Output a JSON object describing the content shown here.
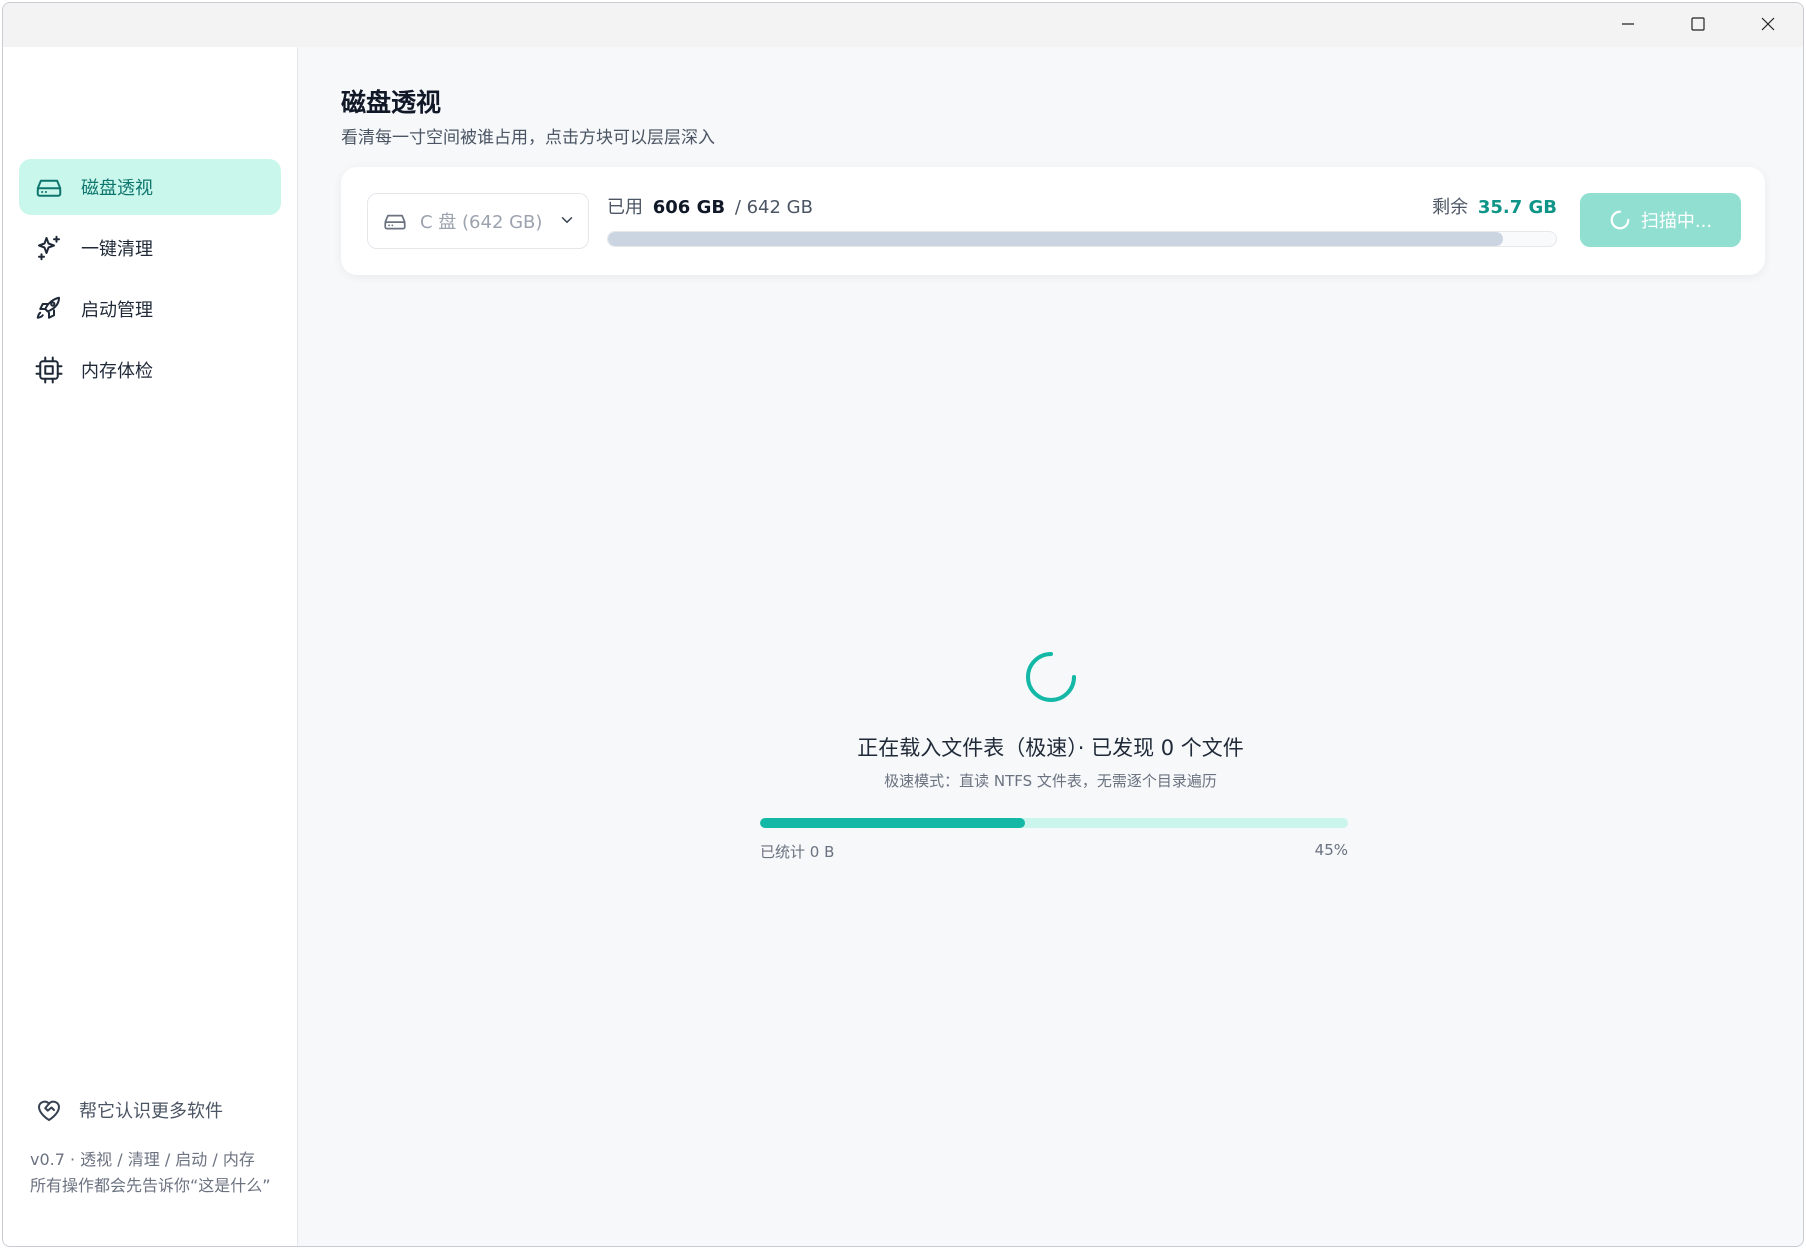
{
  "colors": {
    "accent": "#14b8a6",
    "accent_dark": "#0f766e",
    "active_nav_bg": "#c9f7ec",
    "scan_button_bg": "#90dfd1",
    "usage_bar_fill": "#cbd5e1"
  },
  "window_controls": {
    "minimize_icon": "minimize-icon",
    "maximize_icon": "maximize-icon",
    "close_icon": "close-icon"
  },
  "sidebar": {
    "items": [
      {
        "label": "磁盘透视",
        "icon": "hard-drive-icon",
        "active": true
      },
      {
        "label": "一键清理",
        "icon": "sparkles-icon",
        "active": false
      },
      {
        "label": "启动管理",
        "icon": "rocket-icon",
        "active": false
      },
      {
        "label": "内存体检",
        "icon": "cpu-chip-icon",
        "active": false
      }
    ],
    "promo": {
      "label": "帮它认识更多软件",
      "icon": "heart-handshake-icon"
    },
    "version": "v0.7 · 透视 / 清理 / 启动 / 内存",
    "tagline": "所有操作都会先告诉你“这是什么”"
  },
  "header": {
    "title": "磁盘透视",
    "subtitle": "看清每一寸空间被谁占用，点击方块可以层层深入"
  },
  "disk_card": {
    "drive_select_value": "C 盘 (642 GB)",
    "used_label": "已用",
    "used_value": "606 GB",
    "total_value": "/ 642 GB",
    "free_label": "剩余",
    "free_value": "35.7 GB",
    "used_fraction": 0.944,
    "scan_button_label": "扫描中..."
  },
  "loading": {
    "status": "正在载入文件表（极速）· 已发现 0 个文件",
    "mode_note": "极速模式：直读 NTFS 文件表，无需逐个目录遍历",
    "counted_label": "已统计 0 B",
    "percent_label": "45%",
    "progress_fraction": 0.45
  }
}
